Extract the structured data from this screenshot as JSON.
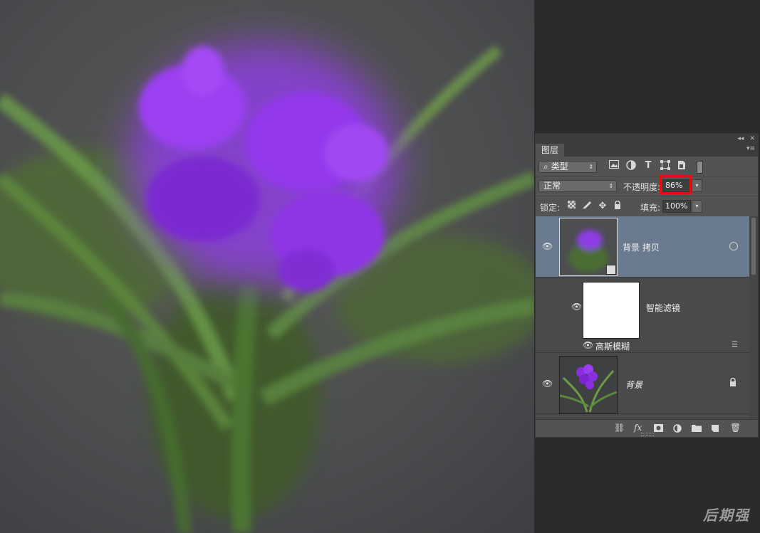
{
  "panel": {
    "collapse_glyph": "◂◂",
    "close_glyph": "✕",
    "tab_label": "图层",
    "menu_glyph": "▾≡",
    "filter": {
      "value": "类型",
      "search_glyph": "⌕"
    },
    "filter_icons": [
      "image-filter-icon",
      "adjustment-filter-icon",
      "type-filter-icon",
      "shape-filter-icon",
      "smart-object-filter-icon"
    ],
    "blend_mode": "正常",
    "opacity_label": "不透明度:",
    "opacity_value": "86%",
    "lock_label": "锁定:",
    "fill_label": "填充:",
    "fill_value": "100%",
    "dropdown_glyph": "▾",
    "updown_glyph": "⇕"
  },
  "layers": [
    {
      "name": "背景 拷贝",
      "selected": true,
      "visible": true
    },
    {
      "name": "智能滤镜",
      "visible": true
    },
    {
      "name": "高斯模糊",
      "visible": true
    },
    {
      "name": "背景",
      "visible": true,
      "locked": true
    }
  ],
  "watermark": "后期强",
  "colors": {
    "selected_row": "#6b7b8f",
    "highlight": "#e01010",
    "flower": "#9b3ff2"
  }
}
